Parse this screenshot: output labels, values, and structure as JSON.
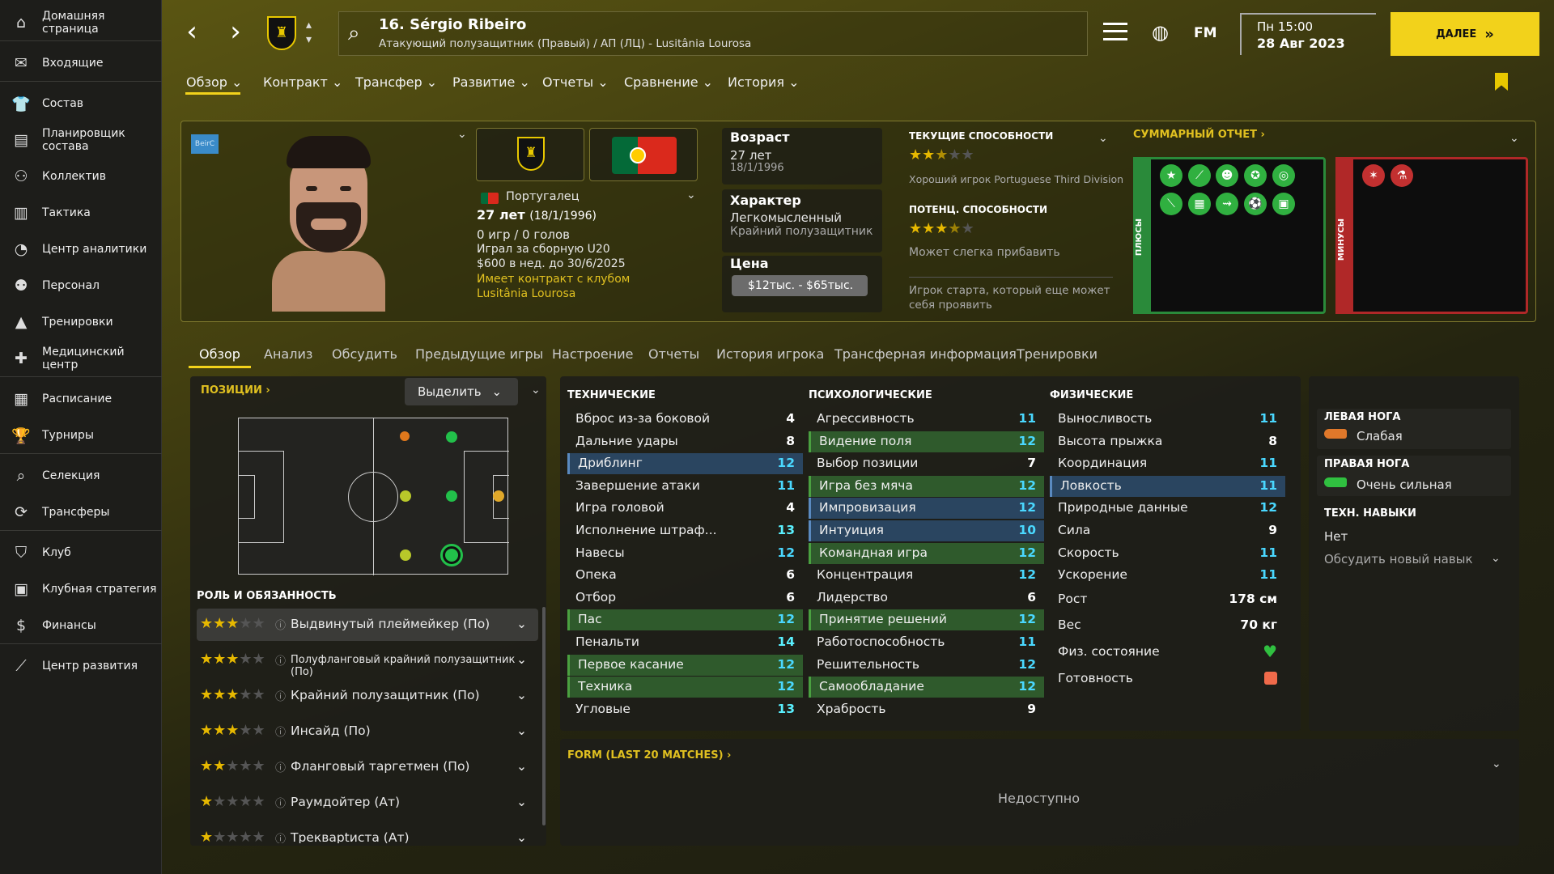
{
  "sidebar": {
    "items": [
      {
        "label": "Домашняя страница",
        "icon": "home-icon"
      },
      {
        "label": "Входящие",
        "icon": "inbox-icon"
      },
      {
        "label": "Состав",
        "icon": "squad-icon"
      },
      {
        "label": "Планировщик состава",
        "icon": "planner-icon"
      },
      {
        "label": "Коллектив",
        "icon": "team-icon"
      },
      {
        "label": "Тактика",
        "icon": "tactics-icon"
      },
      {
        "label": "Центр аналитики",
        "icon": "analytics-icon"
      },
      {
        "label": "Персонал",
        "icon": "staff-icon"
      },
      {
        "label": "Тренировки",
        "icon": "training-icon"
      },
      {
        "label": "Медицинский центр",
        "icon": "medical-icon"
      },
      {
        "label": "Расписание",
        "icon": "schedule-icon"
      },
      {
        "label": "Турниры",
        "icon": "trophy-icon"
      },
      {
        "label": "Селекция",
        "icon": "scouting-icon"
      },
      {
        "label": "Трансферы",
        "icon": "transfers-icon"
      },
      {
        "label": "Клуб",
        "icon": "club-icon"
      },
      {
        "label": "Клубная стратегия",
        "icon": "strategy-icon"
      },
      {
        "label": "Финансы",
        "icon": "finances-icon"
      },
      {
        "label": "Центр развития",
        "icon": "development-icon"
      }
    ]
  },
  "header": {
    "player_name": "16. Sérgio Ribeiro",
    "player_subtitle": "Атакующий полузащитник (Правый) / АП (ЛЦ) - Lusitânia Lourosa",
    "day_time": "Пн 15:00",
    "date": "28 Авг 2023",
    "next_label": "ДАЛЕЕ",
    "fm_label": "FM"
  },
  "menu": [
    "Обзор",
    "Контракт",
    "Трансфер",
    "Развитие",
    "Отчеты",
    "Сравнение",
    "История"
  ],
  "profile": {
    "badge_text": "BeirC",
    "nationality": "Португалец",
    "age_line": "27 лет",
    "dob_paren": "(18/1/1996)",
    "caps": "0 игр / 0 голов",
    "youth": "Играл за сборную U20",
    "wage": "$600 в нед. до 30/6/2025",
    "contract": "Имеет контракт с клубом Lusitânia Lourosa",
    "age_label": "Возраст",
    "age_value": "27 лет",
    "dob": "18/1/1996",
    "personality_label": "Характер",
    "personality": "Легкомысленный",
    "position_short": "Крайний полузащитник",
    "value_label": "Цена",
    "value": "$12тыс. - $65тыс.",
    "ca_label": "ТЕКУЩИЕ СПОСОБНОСТИ",
    "ca_stars": 2.5,
    "ca_text": "Хороший игрок Portuguese Third Division",
    "pa_label": "ПОТЕНЦ. СПОСОБНОСТИ",
    "pa_stars": 3.5,
    "pa_text": "Может слегка прибавить",
    "summary_note": "Игрок старта, который еще может себя проявить",
    "report_label": "СУММАРНЫЙ ОТЧЕТ",
    "plus_label": "ПЛЮСЫ",
    "minus_label": "МИНУСЫ"
  },
  "tabs": [
    "Обзор",
    "Анализ",
    "Обсудить",
    "Предыдущие игры",
    "Настроение",
    "Отчеты",
    "История игрока",
    "Трансферная информация",
    "Тренировки"
  ],
  "positions": {
    "label": "ПОЗИЦИИ",
    "highlight_label": "Выделить",
    "roles_label": "РОЛЬ И ОБЯЗАННОСТЬ"
  },
  "roles": [
    {
      "stars": 3,
      "name": "Выдвинутый плеймейкер (По)"
    },
    {
      "stars": 3,
      "name": "Полуфланговый крайний полузащитник (По)"
    },
    {
      "stars": 3,
      "name": "Крайний полузащитник (По)"
    },
    {
      "stars": 3,
      "name": "Инсайд (По)"
    },
    {
      "stars": 2,
      "name": "Фланговый таргетмен (По)"
    },
    {
      "stars": 1,
      "name": "Раумдойтер (Ат)"
    },
    {
      "stars": 1,
      "name": "Трекварtиста (Ат)"
    }
  ],
  "technical": {
    "title": "ТЕХНИЧЕСКИЕ",
    "items": [
      {
        "name": "Вброс из-за боковой",
        "value": "4",
        "hl": ""
      },
      {
        "name": "Дальние удары",
        "value": "8",
        "hl": ""
      },
      {
        "name": "Дриблинг",
        "value": "12",
        "hl": "blue"
      },
      {
        "name": "Завершение атаки",
        "value": "11",
        "hl": ""
      },
      {
        "name": "Игра головой",
        "value": "4",
        "hl": ""
      },
      {
        "name": "Исполнение штраф...",
        "value": "13",
        "hl": ""
      },
      {
        "name": "Навесы",
        "value": "12",
        "hl": ""
      },
      {
        "name": "Опека",
        "value": "6",
        "hl": ""
      },
      {
        "name": "Отбор",
        "value": "6",
        "hl": ""
      },
      {
        "name": "Пас",
        "value": "12",
        "hl": "green"
      },
      {
        "name": "Пенальти",
        "value": "14",
        "hl": ""
      },
      {
        "name": "Первое касание",
        "value": "12",
        "hl": "green"
      },
      {
        "name": "Техника",
        "value": "12",
        "hl": "green"
      },
      {
        "name": "Угловые",
        "value": "13",
        "hl": ""
      }
    ]
  },
  "mental": {
    "title": "ПСИХОЛОГИЧЕСКИЕ",
    "items": [
      {
        "name": "Агрессивность",
        "value": "11",
        "hl": ""
      },
      {
        "name": "Видение поля",
        "value": "12",
        "hl": "green"
      },
      {
        "name": "Выбор позиции",
        "value": "7",
        "hl": ""
      },
      {
        "name": "Игра без мяча",
        "value": "12",
        "hl": "green"
      },
      {
        "name": "Импровизация",
        "value": "12",
        "hl": "blue"
      },
      {
        "name": "Интуиция",
        "value": "10",
        "hl": "blue"
      },
      {
        "name": "Командная игра",
        "value": "12",
        "hl": "green"
      },
      {
        "name": "Концентрация",
        "value": "12",
        "hl": ""
      },
      {
        "name": "Лидерство",
        "value": "6",
        "hl": ""
      },
      {
        "name": "Принятие решений",
        "value": "12",
        "hl": "green"
      },
      {
        "name": "Работоспособность",
        "value": "11",
        "hl": ""
      },
      {
        "name": "Решительность",
        "value": "12",
        "hl": ""
      },
      {
        "name": "Самообладание",
        "value": "12",
        "hl": "green"
      },
      {
        "name": "Храбрость",
        "value": "9",
        "hl": ""
      }
    ]
  },
  "physical": {
    "title": "ФИЗИЧЕСКИЕ",
    "items": [
      {
        "name": "Выносливость",
        "value": "11",
        "hl": ""
      },
      {
        "name": "Высота прыжка",
        "value": "8",
        "hl": ""
      },
      {
        "name": "Координация",
        "value": "11",
        "hl": ""
      },
      {
        "name": "Ловкость",
        "value": "11",
        "hl": "blue"
      },
      {
        "name": "Природные данные",
        "value": "12",
        "hl": ""
      },
      {
        "name": "Сила",
        "value": "9",
        "hl": ""
      },
      {
        "name": "Скорость",
        "value": "11",
        "hl": ""
      },
      {
        "name": "Ускорение",
        "value": "11",
        "hl": ""
      }
    ],
    "height_label": "Рост",
    "height": "178 см",
    "weight_label": "Вес",
    "weight": "70 кг",
    "condition_label": "Физ. состояние",
    "fitness_label": "Готовность"
  },
  "feet": {
    "left_label": "ЛЕВАЯ НОГА",
    "left_value": "Слабая",
    "right_label": "ПРАВАЯ НОГА",
    "right_value": "Очень сильная",
    "skills_label": "ТЕХН. НАВЫКИ",
    "skills_value": "Нет",
    "discuss_skill": "Обсудить новый навык"
  },
  "form": {
    "title": "FORM (LAST 20 MATCHES)",
    "unavailable": "Недоступно"
  },
  "colors": {
    "accent": "#f2d21b",
    "highlight_green": "#2f5a2c",
    "highlight_blue": "#2a4560",
    "positive": "#30b040",
    "negative": "#c23030"
  }
}
